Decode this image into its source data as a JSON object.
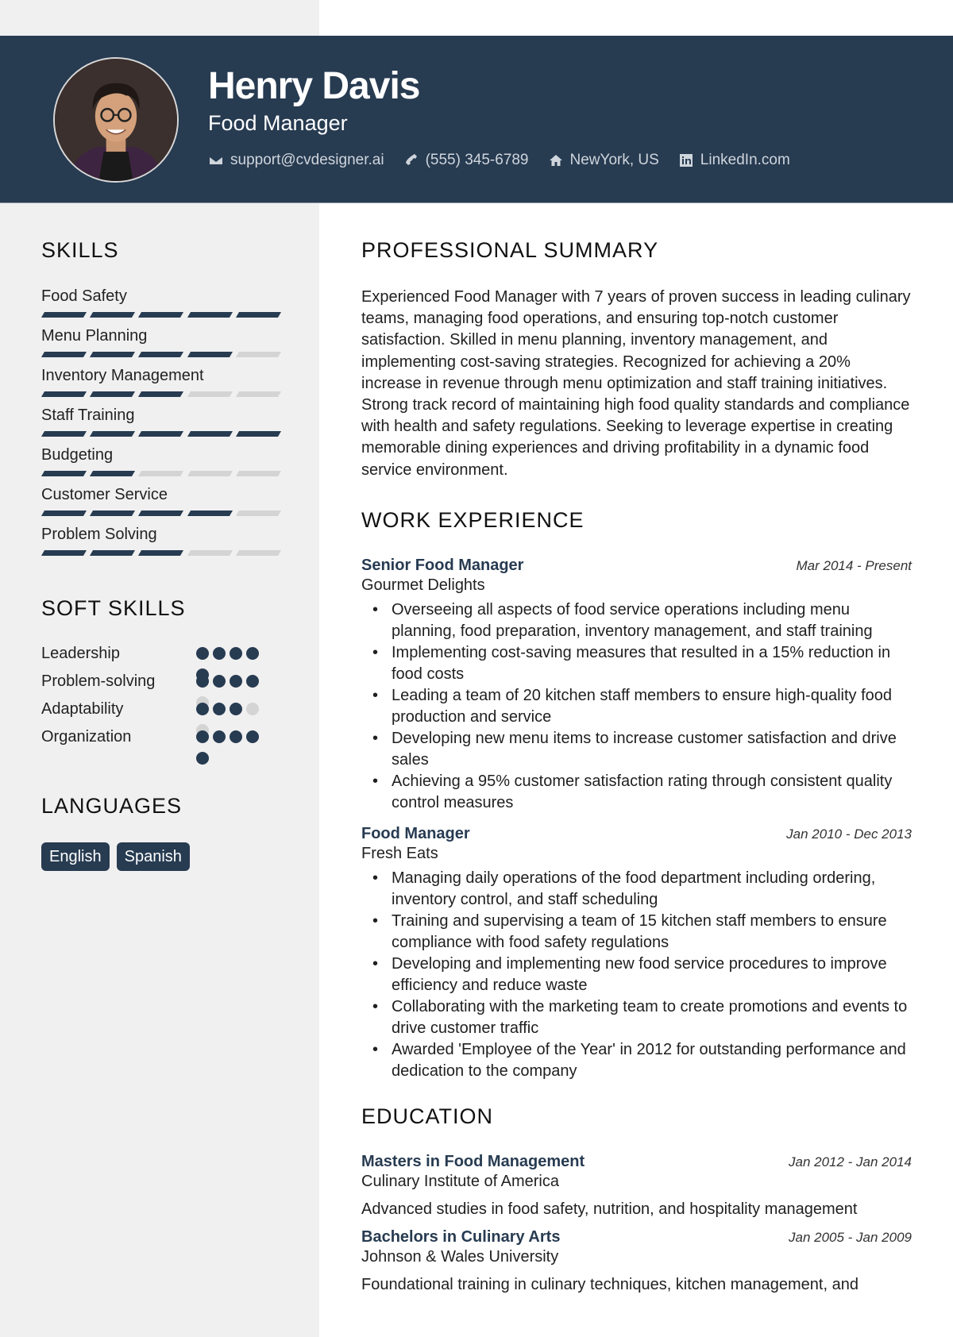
{
  "header": {
    "name": "Henry Davis",
    "title": "Food Manager",
    "contacts": [
      {
        "icon": "envelope-icon",
        "text": "support@cvdesigner.ai"
      },
      {
        "icon": "phone-icon",
        "text": "(555) 345-6789"
      },
      {
        "icon": "home-icon",
        "text": "NewYork, US"
      },
      {
        "icon": "linkedin-icon",
        "text": "LinkedIn.com"
      }
    ]
  },
  "colors": {
    "primary": "#273b51",
    "sidebar": "#f0f0f0",
    "inactive": "#d4d4d4"
  },
  "sidebar": {
    "skills_title": "SKILLS",
    "skills": [
      {
        "name": "Food Safety",
        "level": 5,
        "max": 5
      },
      {
        "name": "Menu Planning",
        "level": 4,
        "max": 5
      },
      {
        "name": "Inventory Management",
        "level": 3,
        "max": 5
      },
      {
        "name": "Staff Training",
        "level": 5,
        "max": 5
      },
      {
        "name": "Budgeting",
        "level": 2,
        "max": 5
      },
      {
        "name": "Customer Service",
        "level": 4,
        "max": 5
      },
      {
        "name": "Problem Solving",
        "level": 3,
        "max": 5
      }
    ],
    "soft_title": "SOFT SKILLS",
    "soft_skills": [
      {
        "name": "Leadership",
        "level": 5,
        "max": 5
      },
      {
        "name": "Problem-solving",
        "level": 4,
        "max": 5
      },
      {
        "name": "Adaptability",
        "level": 3,
        "max": 5
      },
      {
        "name": "Organization",
        "level": 5,
        "max": 5
      }
    ],
    "languages_title": "LANGUAGES",
    "languages": [
      "English",
      "Spanish"
    ]
  },
  "main": {
    "summary_title": "PROFESSIONAL SUMMARY",
    "summary": "Experienced Food Manager with 7 years of proven success in leading culinary teams, managing food operations, and ensuring top-notch customer satisfaction. Skilled in menu planning, inventory management, and implementing cost-saving strategies. Recognized for achieving a 20% increase in revenue through menu optimization and staff training initiatives. Strong track record of maintaining high food quality standards and compliance with health and safety regulations. Seeking to leverage expertise in creating memorable dining experiences and driving profitability in a dynamic food service environment.",
    "experience_title": "WORK EXPERIENCE",
    "jobs": [
      {
        "title": "Senior Food Manager",
        "date": "Mar 2014 - Present",
        "company": "Gourmet Delights",
        "bullets": [
          "Overseeing all aspects of food service operations including menu planning, food preparation, inventory management, and staff training",
          "Implementing cost-saving measures that resulted in a 15% reduction in food costs",
          "Leading a team of 20 kitchen staff members to ensure high-quality food production and service",
          "Developing new menu items to increase customer satisfaction and drive sales",
          "Achieving a 95% customer satisfaction rating through consistent quality control measures"
        ]
      },
      {
        "title": "Food Manager",
        "date": "Jan 2010 - Dec 2013",
        "company": "Fresh Eats",
        "bullets": [
          "Managing daily operations of the food department including ordering, inventory control, and staff scheduling",
          "Training and supervising a team of 15 kitchen staff members to ensure compliance with food safety regulations",
          "Developing and implementing new food service procedures to improve efficiency and reduce waste",
          "Collaborating with the marketing team to create promotions and events to drive customer traffic",
          "Awarded 'Employee of the Year' in 2012 for outstanding performance and dedication to the company"
        ]
      }
    ],
    "education_title": "EDUCATION",
    "education": [
      {
        "degree": "Masters in Food Management",
        "date": "Jan 2012 - Jan 2014",
        "school": "Culinary Institute of America",
        "desc": "Advanced studies in food safety, nutrition, and hospitality management"
      },
      {
        "degree": "Bachelors in Culinary Arts",
        "date": "Jan 2005 - Jan 2009",
        "school": "Johnson & Wales University",
        "desc": "Foundational training in culinary techniques, kitchen management, and"
      }
    ]
  }
}
